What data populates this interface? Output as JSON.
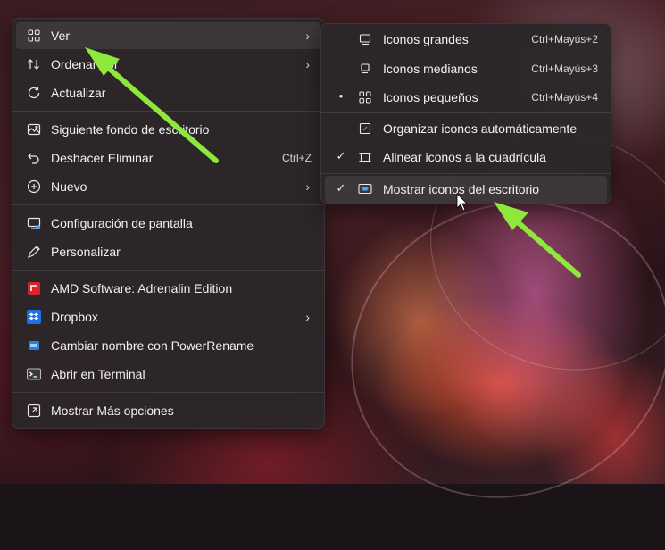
{
  "colors": {
    "arrow": "#8ee83c",
    "menu_bg": "#2c262a",
    "text": "#f2f2f2"
  },
  "main_menu": {
    "items": [
      {
        "label": "Ver",
        "icon": "grid-icon",
        "submenu": true
      },
      {
        "label": "Ordenar por",
        "icon": "sort-icon",
        "submenu": true
      },
      {
        "label": "Actualizar",
        "icon": "refresh-icon"
      },
      {
        "label": "Siguiente fondo de escritorio",
        "icon": "next-wallpaper-icon"
      },
      {
        "label": "Deshacer Eliminar",
        "icon": "undo-icon",
        "shortcut": "Ctrl+Z"
      },
      {
        "label": "Nuevo",
        "icon": "plus-circle-icon",
        "submenu": true
      },
      {
        "label": "Configuración de pantalla",
        "icon": "display-icon"
      },
      {
        "label": "Personalizar",
        "icon": "pencil-icon"
      },
      {
        "label": "AMD Software: Adrenalin Edition",
        "icon": "amd-icon"
      },
      {
        "label": "Dropbox",
        "icon": "dropbox-icon",
        "submenu": true
      },
      {
        "label": "Cambiar nombre con PowerRename",
        "icon": "powerrename-icon"
      },
      {
        "label": "Abrir en Terminal",
        "icon": "terminal-icon"
      },
      {
        "label": "Mostrar Más opciones",
        "icon": "more-options-icon"
      }
    ]
  },
  "sub_menu": {
    "items": [
      {
        "label": "Iconos grandes",
        "icon": "large-icons-icon",
        "shortcut": "Ctrl+Mayús+2",
        "mark": ""
      },
      {
        "label": "Iconos medianos",
        "icon": "medium-icons-icon",
        "shortcut": "Ctrl+Mayús+3",
        "mark": ""
      },
      {
        "label": "Iconos pequeños",
        "icon": "small-icons-icon",
        "shortcut": "Ctrl+Mayús+4",
        "mark": "•"
      },
      {
        "label": "Organizar iconos automáticamente",
        "icon": "auto-arrange-icon",
        "mark": ""
      },
      {
        "label": "Alinear iconos a la cuadrícula",
        "icon": "align-grid-icon",
        "mark": "✓"
      },
      {
        "label": "Mostrar iconos del escritorio",
        "icon": "show-desktop-icon",
        "mark": "✓"
      }
    ]
  },
  "arrow_glyph": "›"
}
